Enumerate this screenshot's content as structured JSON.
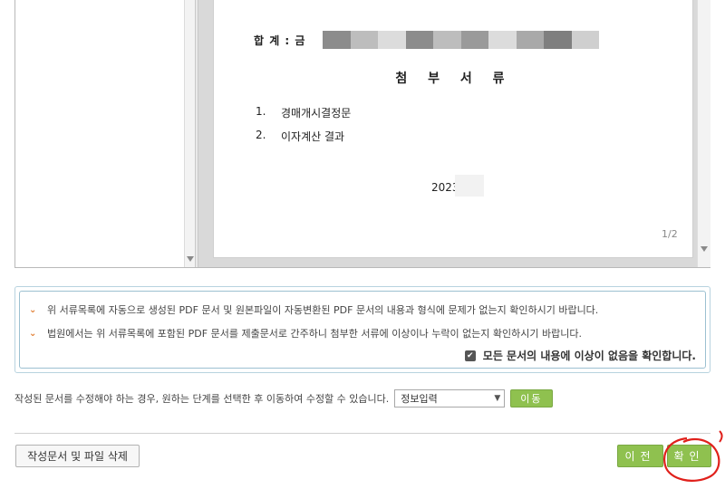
{
  "document": {
    "total_label": "합  계 : 금",
    "title": "첨 부 서 류",
    "attachments": [
      {
        "num": "1.",
        "text": "경매개시결정문"
      },
      {
        "num": "2.",
        "text": "이자계산 결과"
      }
    ],
    "date": "2023.",
    "page_indicator": "1/2"
  },
  "notice": {
    "line1": "위 서류목록에 자동으로 생성된 PDF 문서 및 원본파일이 자동변환된 PDF 문서의 내용과 형식에 문제가 없는지 확인하시기 바랍니다.",
    "line2": "법원에서는 위 서류목록에 포함된 PDF 문서를 제출문서로 간주하니 첨부한 서류에 이상이나 누락이 없는지 확인하시기 바랍니다.",
    "confirm_label": "모든 문서의 내용에 이상이 없음을 확인합니다.",
    "confirm_checked": "✔"
  },
  "edit_step": {
    "instruction": "작성된 문서를 수정해야 하는 경우, 원하는 단계를 선택한 후 이동하여 수정할 수 있습니다.",
    "selected_step": "정보입력",
    "move_label": "이동"
  },
  "buttons": {
    "delete_label": "작성문서 및 파일 삭제",
    "prev_label": "이전",
    "confirm_label": "확인"
  },
  "colors": {
    "accent_green": "#8fc14f",
    "chevron_orange": "#e07b2e",
    "annotation_red": "#e0201b",
    "notice_border": "#9cc0d1"
  },
  "redaction_shades": [
    "#8c8c8c",
    "#bdbdbd",
    "#dcdcdc",
    "#8c8c8c",
    "#bdbdbd",
    "#9a9a9a",
    "#dcdcdc",
    "#a9a9a9",
    "#7f7f7f",
    "#cfcfcf"
  ]
}
